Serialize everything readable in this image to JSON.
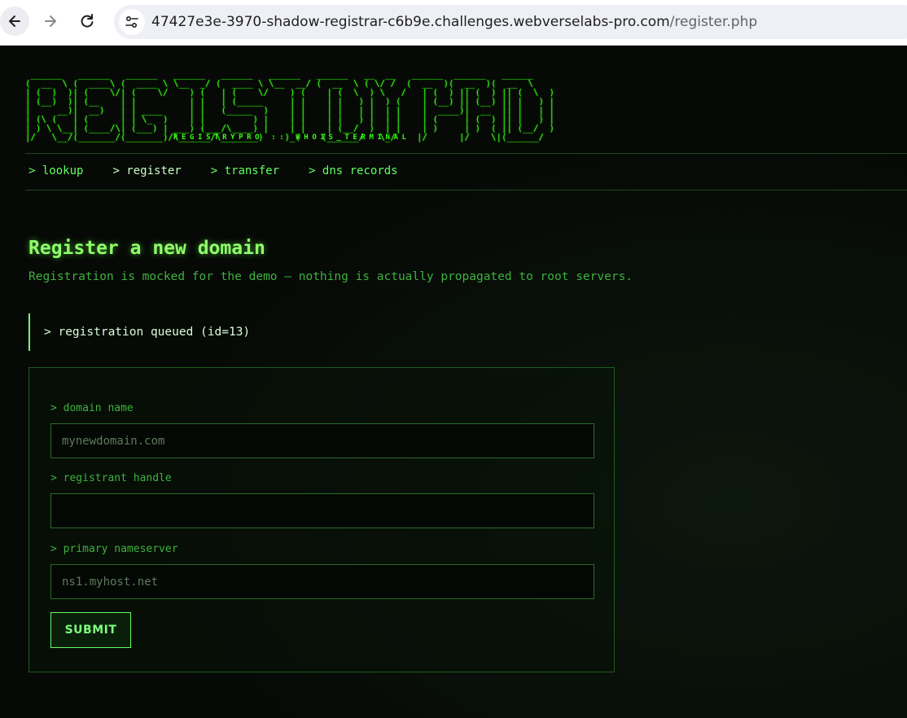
{
  "browser": {
    "url_host": "47427e3e-3970-shadow-registrar-c6b9e.challenges.webverselabs-pro.com",
    "url_path": "/register.php"
  },
  "logo": {
    "ascii": " ______   ______   ______   ______   ______   ______   ______   __  __   ______  ______   ______    \n(  __  \\ (  ____\\ (  ____ \\ \\__  _/ (  ____ \\ \\__  __/ (  __  \\ ( \\/ /  (  __  )(  __  )(  __  \\   \n| (  )  )| (    \\/| (    \\/    ) (   | (    \\/    ) (    | (  \\  ) \\   /   | (  ) || (  ) || (  \\  )  \n| (__)  )| (__    | |          | |   | (_____     | |    | |   ) |  ) (    | (__) || (__) || |   ) |  \n|     __)|  __)   | | ____     | |   (_____  )    | |    | |   | |  | |    |  ____)|  __  || |   | |  \n| (\\ (   | (      | | \\_  )    | |         ) |    | |    | |   ) |  | |    | (     | (  ) || |   ) |  \n| ) \\ \\__| (____/\\| (___) | ___) (___/\\____) |    | |    | (__/  )  | |    | )     | )  ( || (__/  )  \n|/   \\__/(_______/(_______)/\\______/\\_______)    )_(    (______/   \\_/    |/      |/    \\|(______/   ",
    "subtitle": "REGISTRYPRO :: WHOIS_TERMINAL"
  },
  "nav": {
    "items": [
      {
        "label": "> lookup"
      },
      {
        "label": "> register"
      },
      {
        "label": "> transfer"
      },
      {
        "label": "> dns records"
      }
    ]
  },
  "main": {
    "title": "Register a new domain",
    "subtitle": "Registration is mocked for the demo — nothing is actually propagated to root servers.",
    "alert": "> registration queued (id=13)"
  },
  "form": {
    "domain_label": "> domain name",
    "domain_placeholder": "mynewdomain.com",
    "handle_label": "> registrant handle",
    "handle_placeholder": "",
    "ns_label": "> primary nameserver",
    "ns_placeholder": "ns1.myhost.net",
    "submit_label": "SUBMIT"
  },
  "colors": {
    "accent": "#39ff14",
    "text": "#5fd35f",
    "background": "#060906"
  }
}
